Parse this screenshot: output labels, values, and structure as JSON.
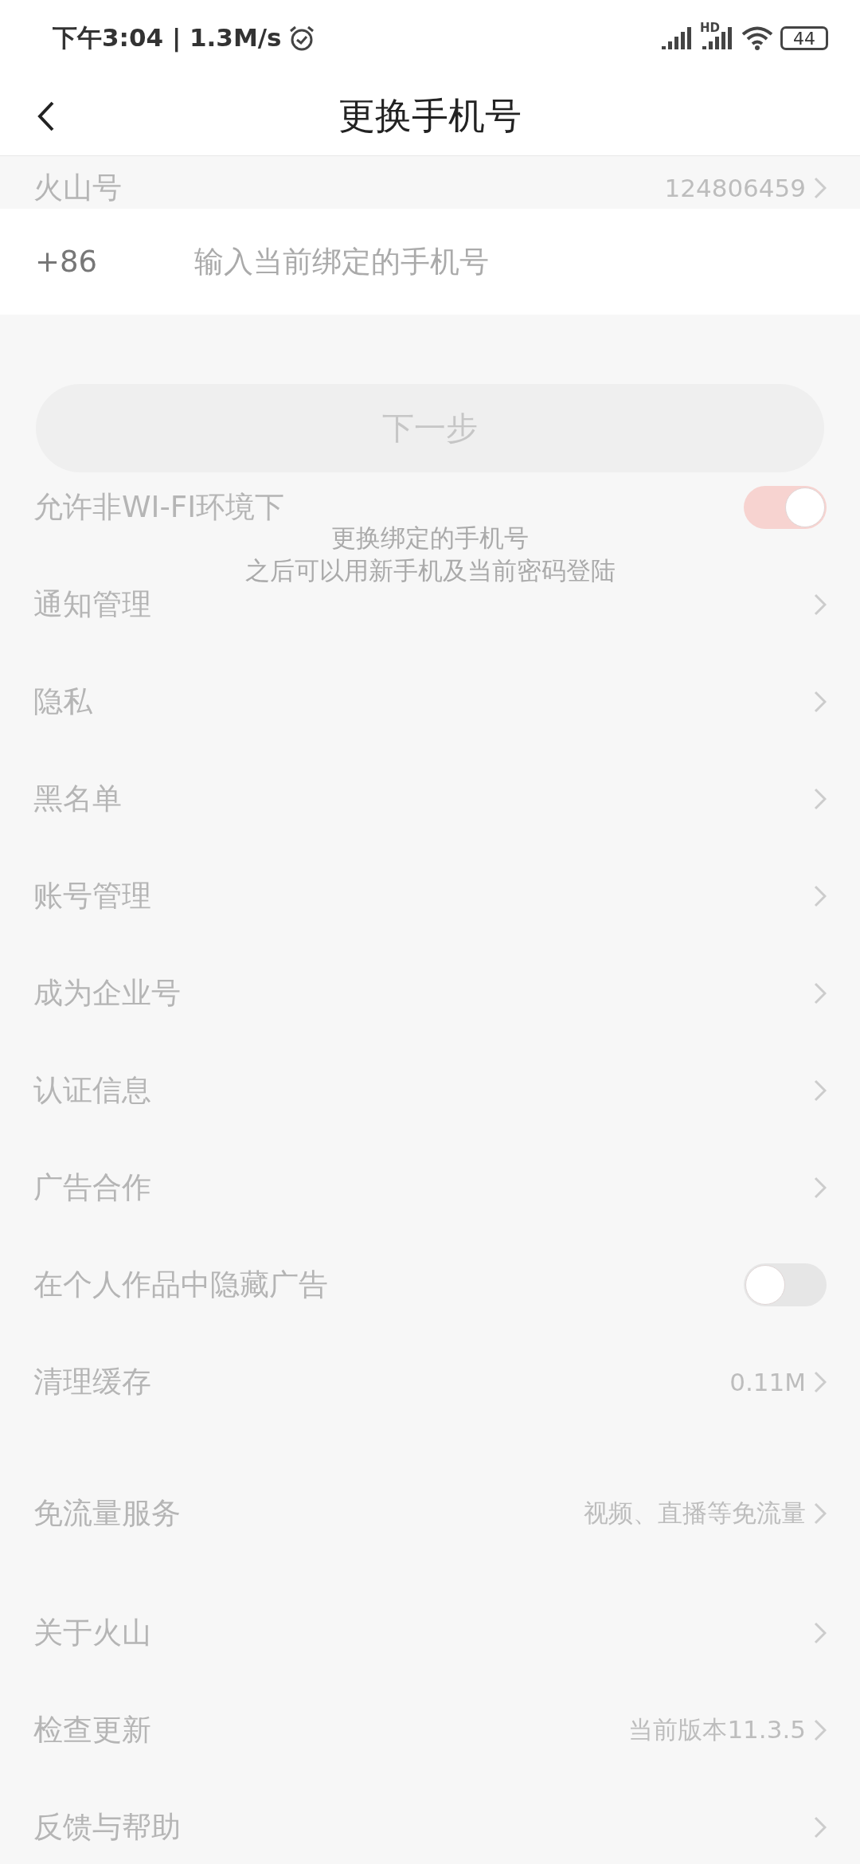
{
  "status_bar": {
    "time_speed": "下午3:04 | 1.3M/s",
    "network_label": "HD",
    "battery": "44"
  },
  "header": {
    "title": "更换手机号"
  },
  "phone_form": {
    "country_code": "+86",
    "placeholder": "输入当前绑定的手机号",
    "button": "下一步",
    "disabled": true,
    "hint_lines": [
      "更换绑定的手机号",
      "之后可以用新手机及当前密码登陆"
    ]
  },
  "background_settings": {
    "sections": [
      {
        "rows": [
          {
            "kind": "link",
            "label": "火山号",
            "value": "124806459"
          }
        ]
      },
      {
        "rows": [
          {
            "kind": "toggle",
            "label": "允许非WI-FI环境下",
            "on": true
          },
          {
            "kind": "link",
            "label": "通知管理"
          },
          {
            "kind": "link",
            "label": "隐私"
          },
          {
            "kind": "link",
            "label": "黑名单"
          },
          {
            "kind": "link",
            "label": "账号管理"
          },
          {
            "kind": "link",
            "label": "成为企业号"
          },
          {
            "kind": "link",
            "label": "认证信息"
          },
          {
            "kind": "link",
            "label": "广告合作"
          },
          {
            "kind": "toggle",
            "label": "在个人作品中隐藏广告",
            "on": false
          },
          {
            "kind": "link",
            "label": "清理缓存",
            "value": "0.11M"
          }
        ]
      },
      {
        "rows": [
          {
            "kind": "link",
            "label": "免流量服务",
            "value": "视频、直播等免流量"
          }
        ]
      },
      {
        "rows": [
          {
            "kind": "link",
            "label": "关于火山"
          },
          {
            "kind": "link",
            "label": "检查更新",
            "value": "当前版本11.3.5"
          },
          {
            "kind": "link",
            "label": "反馈与帮助"
          }
        ]
      }
    ]
  }
}
